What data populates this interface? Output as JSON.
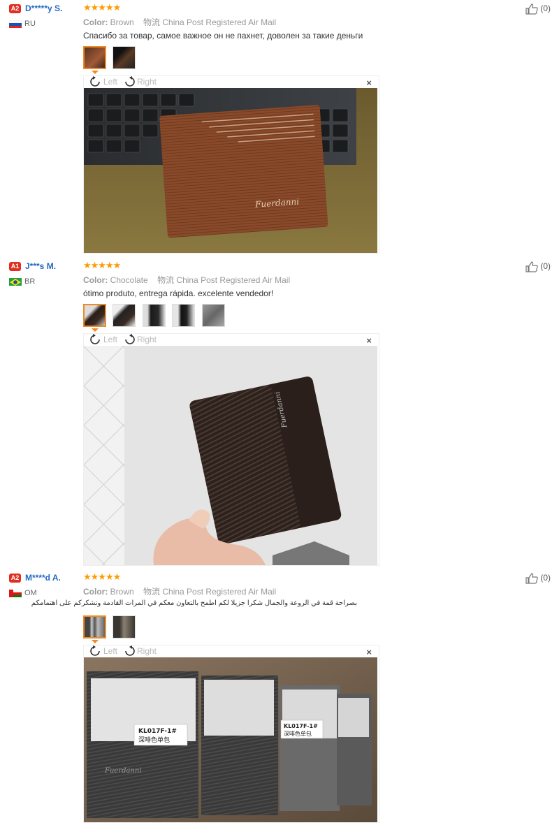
{
  "reviews": [
    {
      "level": "A2",
      "name": "D*****y S.",
      "country": "RU",
      "stars": "★★★★★",
      "color_label": "Color:",
      "color_value": "Brown",
      "shipping": "物流 China Post Registered Air Mail",
      "text": "Спасибо за товар, самое важное он не пахнет, доволен за такие деньги",
      "likes": "(0)",
      "rotate_left": "Left",
      "rotate_right": "Right",
      "close": "×",
      "brand_on_wallet": "Fuerdanni"
    },
    {
      "level": "A1",
      "name": "J***s M.",
      "country": "BR",
      "stars": "★★★★★",
      "color_label": "Color:",
      "color_value": "Chocolate",
      "shipping": "物流 China Post Registered Air Mail",
      "text": "ótimo produto, entrega rápida. excelente vendedor!",
      "likes": "(0)",
      "rotate_left": "Left",
      "rotate_right": "Right",
      "close": "×",
      "brand_on_wallet": "Fuerdanni"
    },
    {
      "level": "A2",
      "name": "M****d A.",
      "country": "OM",
      "stars": "★★★★★",
      "color_label": "Color:",
      "color_value": "Brown",
      "shipping": "物流 China Post Registered Air Mail",
      "text": "بصراحة قمة في الروعة والجمال شكرا جزيلا لكم اطمح بالتعاون معكم في المرات القادمة وتشكركم على اهتمامكم",
      "likes": "(0)",
      "rotate_left": "Left",
      "rotate_right": "Right",
      "close": "×",
      "label_code": "KL017F-1#",
      "label_cn": "深啡色单包",
      "brand_on_wallet": "Fuerdanni"
    }
  ],
  "colors": {
    "star": "#ff9a00",
    "badge": "#e02f22",
    "username": "#2468c4",
    "selected_thumb": "#f08a24"
  }
}
